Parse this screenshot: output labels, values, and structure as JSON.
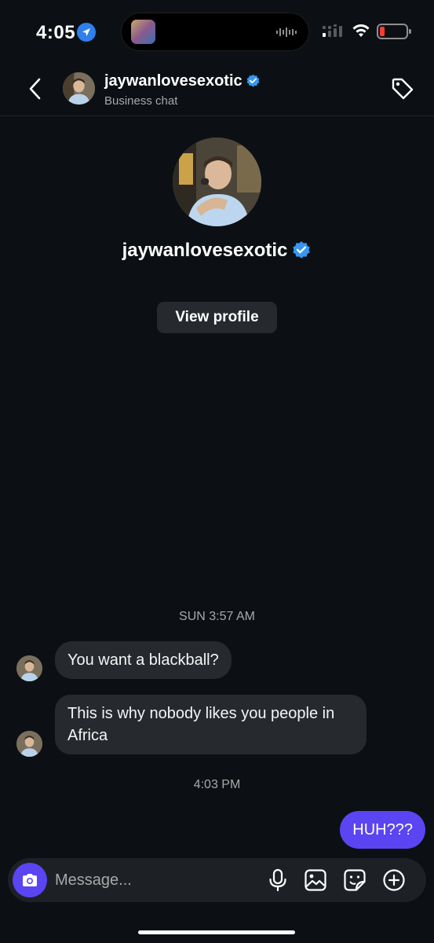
{
  "status_bar": {
    "time": "4:05",
    "location_icon": "location-arrow-icon",
    "signal_icon": "cellular-signal-icon",
    "wifi_icon": "wifi-icon",
    "battery_icon": "battery-low-icon",
    "battery_color": "#ff3b30"
  },
  "header": {
    "back_icon": "chevron-left-icon",
    "username": "jaywanlovesexotic",
    "verified_icon": "verified-badge-icon",
    "subtitle": "Business chat",
    "tag_icon": "tag-icon"
  },
  "profile": {
    "username": "jaywanlovesexotic",
    "view_profile_label": "View profile"
  },
  "messages": {
    "timestamp_1": "SUN 3:57 AM",
    "incoming_1": "You want a blackball?",
    "incoming_2": "This is why nobody likes you people in Africa",
    "timestamp_2": "4:03 PM",
    "outgoing_1": "HUH???"
  },
  "composer": {
    "placeholder": "Message...",
    "camera_icon": "camera-icon",
    "mic_icon": "microphone-icon",
    "gallery_icon": "image-icon",
    "sticker_icon": "sticker-icon",
    "plus_icon": "plus-circle-icon"
  },
  "colors": {
    "background": "#0c1014",
    "bubble_incoming": "#262a2f",
    "bubble_outgoing": "#5b44f2",
    "verified": "#3797f0"
  }
}
